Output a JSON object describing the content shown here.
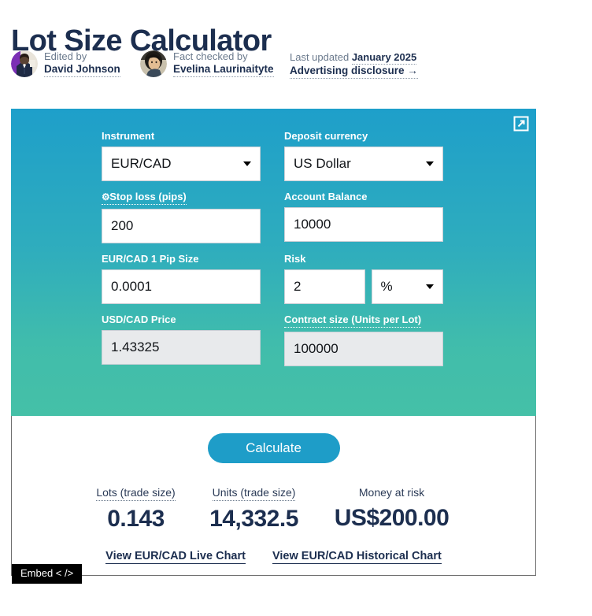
{
  "header": {
    "title": "Lot Size Calculator",
    "edited": {
      "role": "Edited by",
      "name": "David Johnson"
    },
    "fact_checked": {
      "role": "Fact checked by",
      "name": "Evelina Laurinaityte"
    },
    "last_updated": {
      "prefix": "Last updated",
      "date": "January 2025"
    },
    "advertising_disclosure": "Advertising disclosure →"
  },
  "widget": {
    "expand_icon": "external-link-icon",
    "fields": {
      "instrument": {
        "label": "Instrument",
        "value": "EUR/CAD",
        "type": "select"
      },
      "deposit_currency": {
        "label": "Deposit currency",
        "value": "US Dollar",
        "type": "select"
      },
      "stop_loss": {
        "label": "Stop loss (pips)",
        "icon": "gear-icon",
        "value": "200",
        "type": "text"
      },
      "account_balance": {
        "label": "Account Balance",
        "value": "10000",
        "type": "text"
      },
      "pip_size": {
        "label": "EUR/CAD 1 Pip Size",
        "value": "0.0001",
        "type": "text"
      },
      "risk": {
        "label": "Risk",
        "value": "2",
        "unit": "%",
        "type": "split"
      },
      "usd_cad_price": {
        "label": "USD/CAD Price",
        "value": "1.43325",
        "type": "readonly"
      },
      "contract_size": {
        "label": "Contract size (Units per Lot)",
        "value": "100000",
        "type": "readonly"
      }
    },
    "calculate_button": "Calculate",
    "results": [
      {
        "label": "Lots (trade size)",
        "value": "0.143",
        "dotted": true
      },
      {
        "label": "Units (trade size)",
        "value": "14,332.5",
        "dotted": true
      },
      {
        "label": "Money at risk",
        "value": "US$200.00",
        "dotted": false
      }
    ],
    "links": [
      "View EUR/CAD Live Chart",
      "View EUR/CAD Historical Chart"
    ],
    "embed_badge": "Embed < />"
  },
  "colors": {
    "gradient_top": "#1e9fca",
    "gradient_bottom": "#45c0a7",
    "button": "#1e9dc8",
    "navy": "#1c2e4f"
  }
}
